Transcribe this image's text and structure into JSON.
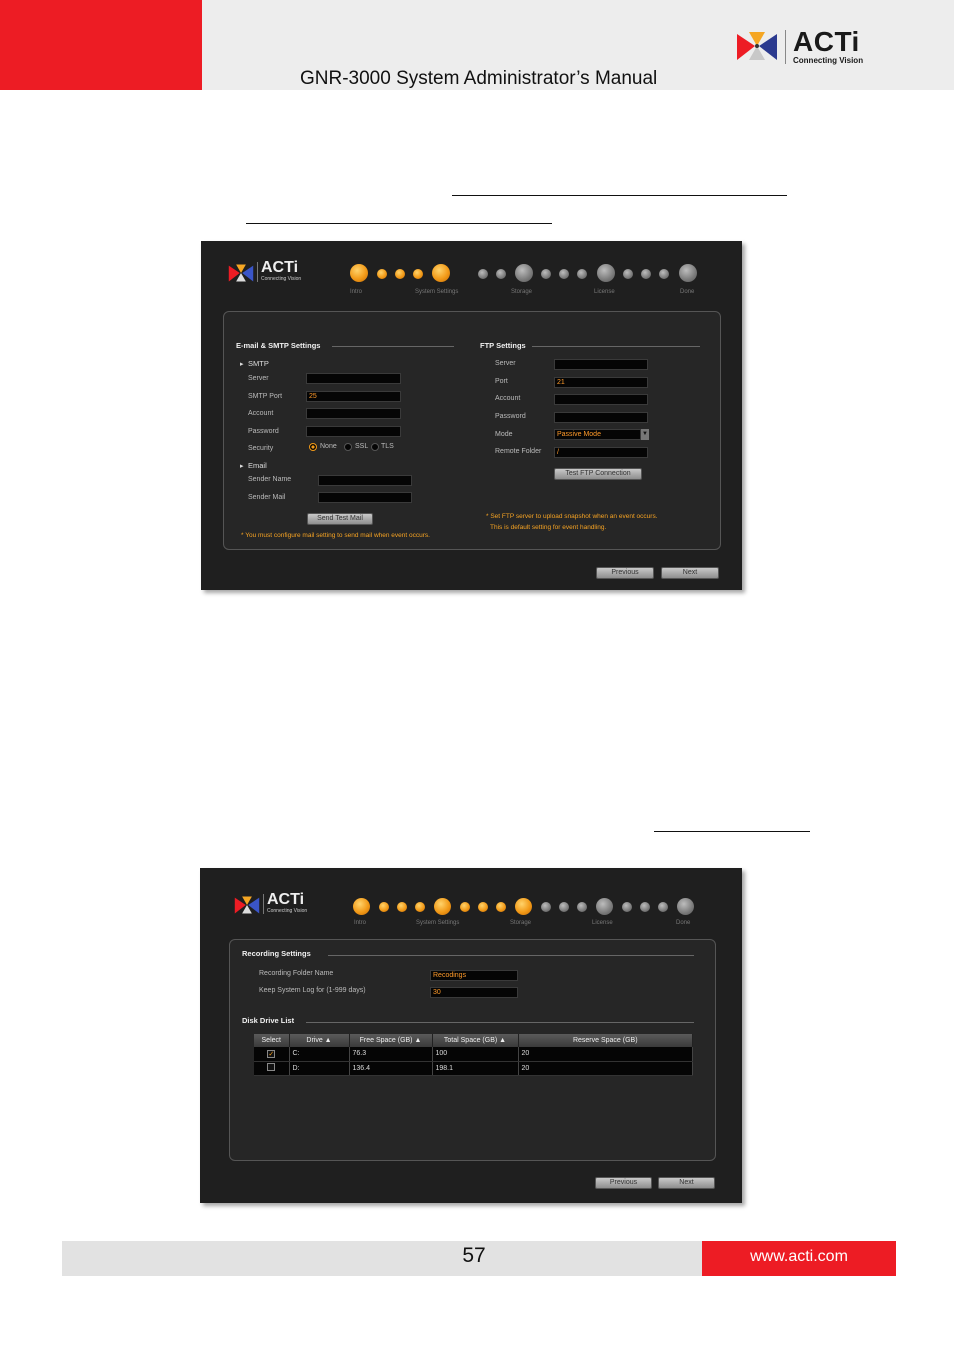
{
  "header": {
    "title": "GNR-3000 System Administrator’s Manual",
    "logo_name": "ACTi",
    "logo_tagline": "Connecting Vision"
  },
  "colors": {
    "brand_red": "#ed1c24",
    "accent_orange": "#f29a18",
    "dark_bg": "#1f1f1f"
  },
  "wizard_steps": [
    "Intro",
    "System Settings",
    "Storage",
    "License",
    "Done"
  ],
  "shot1": {
    "email_section": "E-mail & SMTP Settings",
    "smtp_label": "SMTP",
    "server": "Server",
    "smtp_port": "SMTP Port",
    "smtp_port_value": "25",
    "account": "Account",
    "password": "Password",
    "security": "Security",
    "sec_none": "None",
    "sec_ssl": "SSL",
    "sec_tls": "TLS",
    "email_label": "Email",
    "sender_name": "Sender Name",
    "sender_mail": "Sender Mail",
    "send_test": "Send Test Mail",
    "mail_note": "* You must configure mail setting to send mail when event occurs.",
    "ftp_section": "FTP Settings",
    "ftp_server": "Server",
    "ftp_port": "Port",
    "ftp_port_value": "21",
    "ftp_account": "Account",
    "ftp_password": "Password",
    "ftp_mode": "Mode",
    "ftp_mode_value": "Passive Mode",
    "ftp_remote": "Remote Folder",
    "ftp_remote_value": "/",
    "test_ftp": "Test FTP Connection",
    "ftp_note1": "* Set FTP server to upload snapshot when an event occurs.",
    "ftp_note2": "This is default setting for event handling.",
    "previous": "Previous",
    "next": "Next"
  },
  "shot2": {
    "rec_section": "Recording Settings",
    "rec_folder_label": "Recording Folder Name",
    "rec_folder_value": "Recodings",
    "log_label": "Keep System Log for (1-999 days)",
    "log_value": "30",
    "disk_section": "Disk Drive List",
    "columns": [
      "Select",
      "Drive ▲",
      "Free Space (GB) ▲",
      "Total Space (GB) ▲",
      "Reserve Space (GB)"
    ],
    "rows": [
      {
        "checked": "✓",
        "drive": "C:",
        "free": "76.3",
        "total": "100",
        "reserve": "20"
      },
      {
        "checked": "",
        "drive": "D:",
        "free": "136.4",
        "total": "198.1",
        "reserve": "20"
      }
    ],
    "previous": "Previous",
    "next": "Next"
  },
  "footer": {
    "page_number": "57",
    "url": "www.acti.com"
  }
}
